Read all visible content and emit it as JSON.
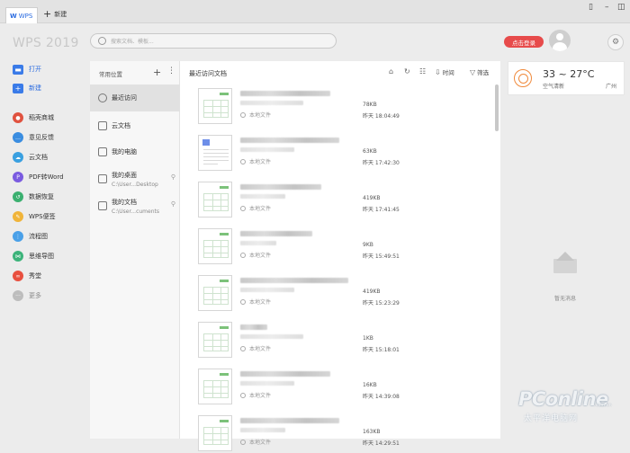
{
  "tabs": {
    "wps_label": "WPS",
    "new_label": "新建"
  },
  "header": {
    "app_title": "WPS 2019",
    "search_placeholder": "搜索文档、模板...",
    "login_label": "点击登录"
  },
  "leftnav": {
    "items": [
      {
        "label": "打开",
        "icon": "folder-icon",
        "color": "#3a7be8"
      },
      {
        "label": "新建",
        "icon": "plus-icon",
        "color": "#3a7be8"
      },
      {
        "label": "稻壳商城",
        "icon": "shop-icon",
        "color": "#e0523f"
      },
      {
        "label": "意见反馈",
        "icon": "feedback-icon",
        "color": "#3a8de0"
      },
      {
        "label": "云文档",
        "icon": "cloud-icon",
        "color": "#3aa0e0"
      },
      {
        "label": "PDF转Word",
        "icon": "pdf-icon",
        "color": "#7a5be0"
      },
      {
        "label": "数据恢复",
        "icon": "recover-icon",
        "color": "#3bb070"
      },
      {
        "label": "WPS便签",
        "icon": "note-icon",
        "color": "#f0b43a"
      },
      {
        "label": "流程图",
        "icon": "flowchart-icon",
        "color": "#4aa0e8"
      },
      {
        "label": "思维导图",
        "icon": "mindmap-icon",
        "color": "#3cb37a"
      },
      {
        "label": "秀堂",
        "icon": "show-icon",
        "color": "#e8503f"
      },
      {
        "label": "更多",
        "icon": "more-icon",
        "color": "#bdbdbd"
      }
    ]
  },
  "locations": {
    "header": "常用位置",
    "items": [
      {
        "label": "最近访问",
        "path": ""
      },
      {
        "label": "云文档",
        "path": ""
      },
      {
        "label": "我的电脑",
        "path": ""
      },
      {
        "label": "我的桌面",
        "path": "C:\\User...Desktop"
      },
      {
        "label": "我的文档",
        "path": "C:\\User...cuments"
      }
    ]
  },
  "main": {
    "title": "最近访问文档",
    "sort_label": "时间",
    "filter_label": "筛选",
    "files": [
      {
        "location": "本地文件",
        "size": "78KB",
        "time": "昨天 18:04:49",
        "kind": "sheet"
      },
      {
        "location": "本地文件",
        "size": "63KB",
        "time": "昨天 17:42:30",
        "kind": "doc"
      },
      {
        "location": "本地文件",
        "size": "419KB",
        "time": "昨天 17:41:45",
        "kind": "sheet"
      },
      {
        "location": "本地文件",
        "size": "9KB",
        "time": "昨天 15:49:51",
        "kind": "sheet"
      },
      {
        "location": "本地文件",
        "size": "419KB",
        "time": "昨天 15:23:29",
        "kind": "sheet"
      },
      {
        "location": "本地文件",
        "size": "1KB",
        "time": "昨天 15:18:01",
        "kind": "sheet"
      },
      {
        "location": "本地文件",
        "size": "16KB",
        "time": "昨天 14:39:08",
        "kind": "sheet"
      },
      {
        "location": "本地文件",
        "size": "163KB",
        "time": "昨天 14:29:51",
        "kind": "sheet"
      }
    ]
  },
  "weather": {
    "temp": "33 ~ 27°C",
    "air": "空气清新",
    "city": "广州"
  },
  "messages": {
    "empty_label": "暂无消息"
  },
  "watermark": {
    "brand": "PConline",
    "sub": "太平洋电脑网",
    "dot": ".com.cn"
  }
}
